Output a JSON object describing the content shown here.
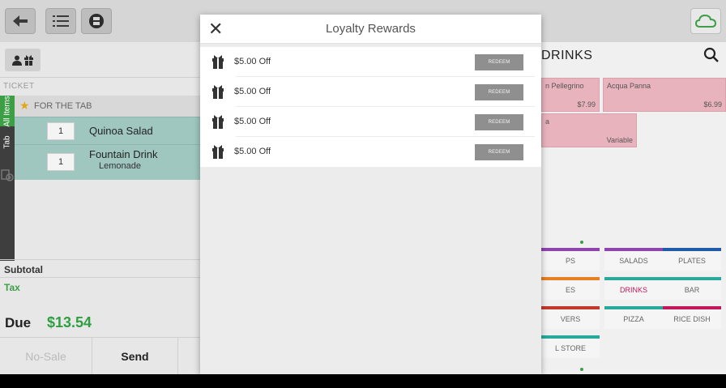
{
  "left": {
    "ticket_label": "TICKET",
    "side_tabs": {
      "all": "All Items",
      "tab": "Tab"
    },
    "for_tab": "FOR THE TAB",
    "items": [
      {
        "qty": "1",
        "name": "Quinoa Salad",
        "mod": ""
      },
      {
        "qty": "1",
        "name": "Fountain Drink",
        "mod": "Lemonade"
      }
    ],
    "subtotal_label": "Subtotal",
    "tax_label": "Tax",
    "due_label": "Due",
    "due_value": "$13.54",
    "buttons": {
      "nosale": "No-Sale",
      "send": "Send"
    }
  },
  "right": {
    "heading": "DRINKS",
    "products": [
      {
        "name": "n Pellegrino",
        "price": "$7.99"
      },
      {
        "name": "Acqua Panna",
        "price": "$6.99"
      },
      {
        "name": "a",
        "price": "Variable"
      }
    ],
    "categories": [
      {
        "label": "PS",
        "color": "#8e44ad"
      },
      {
        "label": "SALADS",
        "color": "#8e44ad"
      },
      {
        "label": "PLATES",
        "color": "#1e5aa8"
      },
      {
        "label": "ES",
        "color": "#e67e22"
      },
      {
        "label": "DRINKS",
        "color": "#2aa89a"
      },
      {
        "label": "BAR",
        "color": "#2aa89a"
      },
      {
        "label": "VERS",
        "color": "#c0392b"
      },
      {
        "label": "PIZZA",
        "color": "#2aa89a"
      },
      {
        "label": "RICE DISH",
        "color": "#c2185b"
      },
      {
        "label": "L STORE",
        "color": "#2aa89a"
      }
    ]
  },
  "modal": {
    "title": "Loyalty Rewards",
    "rewards": [
      {
        "label": "$5.00 Off",
        "button": "REDEEM"
      },
      {
        "label": "$5.00 Off",
        "button": "REDEEM"
      },
      {
        "label": "$5.00 Off",
        "button": "REDEEM"
      },
      {
        "label": "$5.00 Off",
        "button": "REDEEM"
      }
    ]
  },
  "colors": {
    "accent_green": "#3d9e46",
    "due_green": "#2e9e40",
    "item_teal": "#9fc7c0",
    "product_pink": "#e9b3bd"
  }
}
